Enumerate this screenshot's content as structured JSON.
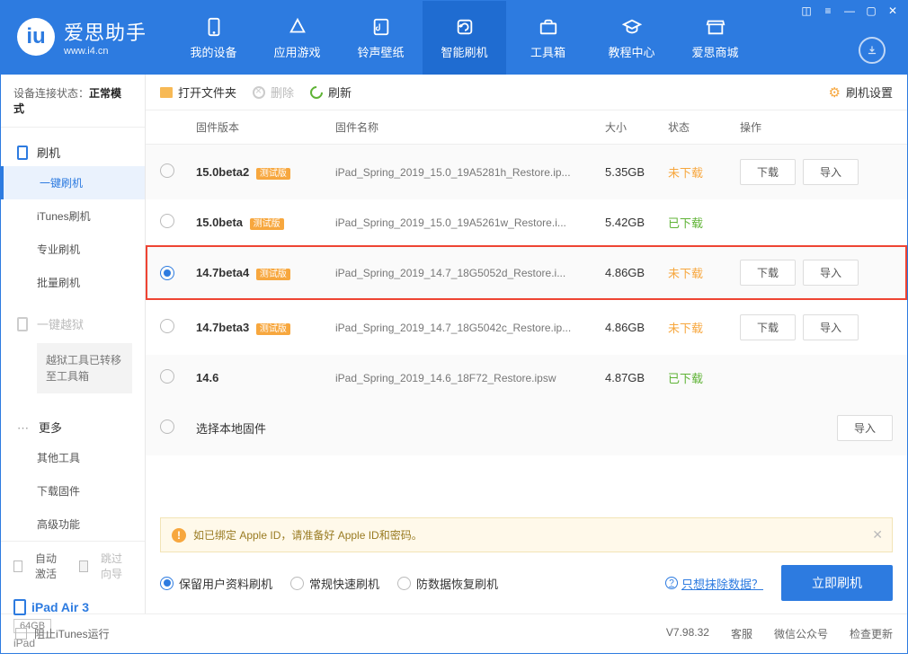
{
  "app": {
    "name": "爱思助手",
    "site": "www.i4.cn"
  },
  "nav": [
    {
      "label": "我的设备"
    },
    {
      "label": "应用游戏"
    },
    {
      "label": "铃声壁纸"
    },
    {
      "label": "智能刷机"
    },
    {
      "label": "工具箱"
    },
    {
      "label": "教程中心"
    },
    {
      "label": "爱思商城"
    }
  ],
  "sidebar": {
    "conn_label": "设备连接状态：",
    "conn_value": "正常模式",
    "flash_head": "刷机",
    "flash_items": [
      "一键刷机",
      "iTunes刷机",
      "专业刷机",
      "批量刷机"
    ],
    "jail_head": "一键越狱",
    "jail_note": "越狱工具已转移至工具箱",
    "more_head": "更多",
    "more_items": [
      "其他工具",
      "下载固件",
      "高级功能"
    ],
    "auto_activate": "自动激活",
    "skip_guide": "跳过向导",
    "device": {
      "name": "iPad Air 3",
      "capacity": "64GB",
      "model": "iPad"
    }
  },
  "toolbar": {
    "open_folder": "打开文件夹",
    "delete": "删除",
    "refresh": "刷新",
    "settings": "刷机设置"
  },
  "columns": {
    "version": "固件版本",
    "name": "固件名称",
    "size": "大小",
    "status": "状态",
    "actions": "操作"
  },
  "badge_beta": "测试版",
  "rows": [
    {
      "version": "15.0beta2",
      "beta": true,
      "name": "iPad_Spring_2019_15.0_19A5281h_Restore.ip...",
      "size": "5.35GB",
      "status": "未下载",
      "status_class": "not",
      "selected": false,
      "download": true,
      "import": true
    },
    {
      "version": "15.0beta",
      "beta": true,
      "name": "iPad_Spring_2019_15.0_19A5261w_Restore.i...",
      "size": "5.42GB",
      "status": "已下载",
      "status_class": "done",
      "selected": false,
      "download": false,
      "import": false
    },
    {
      "version": "14.7beta4",
      "beta": true,
      "name": "iPad_Spring_2019_14.7_18G5052d_Restore.i...",
      "size": "4.86GB",
      "status": "未下载",
      "status_class": "not",
      "selected": true,
      "download": true,
      "import": true,
      "highlight": true
    },
    {
      "version": "14.7beta3",
      "beta": true,
      "name": "iPad_Spring_2019_14.7_18G5042c_Restore.ip...",
      "size": "4.86GB",
      "status": "未下载",
      "status_class": "not",
      "selected": false,
      "download": true,
      "import": true
    },
    {
      "version": "14.6",
      "beta": false,
      "name": "iPad_Spring_2019_14.6_18F72_Restore.ipsw",
      "size": "4.87GB",
      "status": "已下载",
      "status_class": "done",
      "selected": false,
      "download": false,
      "import": false
    }
  ],
  "local_row": "选择本地固件",
  "btn": {
    "download": "下载",
    "import": "导入"
  },
  "notice": "如已绑定 Apple ID，请准备好 Apple ID和密码。",
  "modes": {
    "keep_data": "保留用户资料刷机",
    "fast": "常规快速刷机",
    "recovery": "防数据恢复刷机"
  },
  "erase_link": "只想抹除数据？",
  "flash_now": "立即刷机",
  "footer": {
    "block_itunes": "阻止iTunes运行",
    "version": "V7.98.32",
    "service": "客服",
    "wechat": "微信公众号",
    "update": "检查更新"
  }
}
